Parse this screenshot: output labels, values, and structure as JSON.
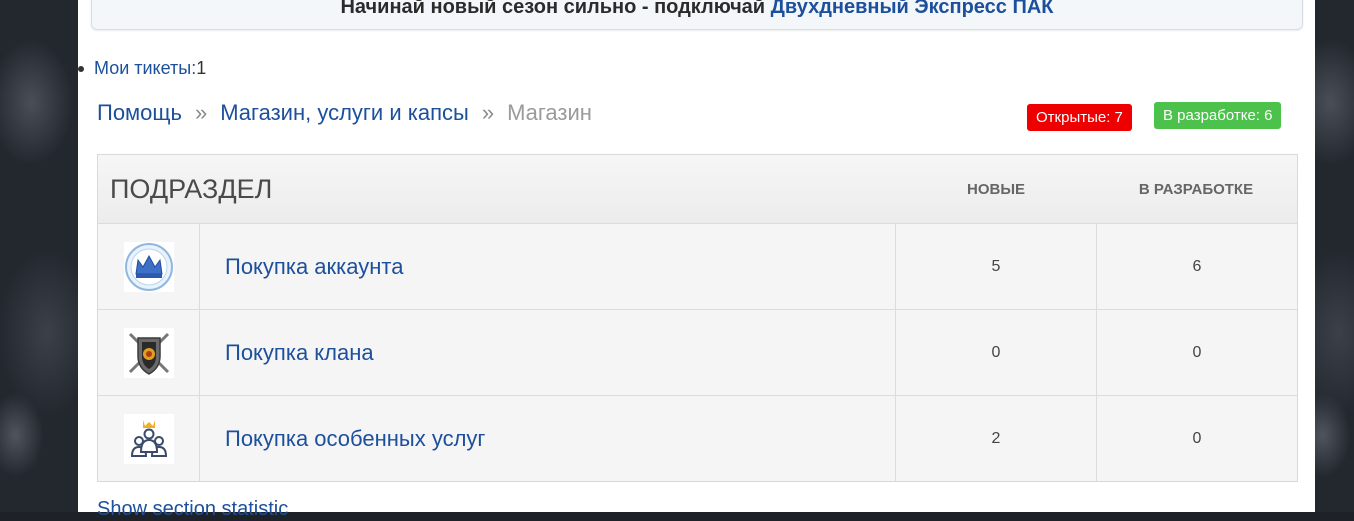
{
  "banner": {
    "text": "Начинай новый сезон сильно - подключай ",
    "highlight": "Двухдневный Экспресс ПАК"
  },
  "tickets": {
    "label": "Мои тикеты:",
    "count": "1"
  },
  "breadcrumb": {
    "items": [
      "Помощь",
      "Магазин, услуги и капсы"
    ],
    "separator": "»",
    "current": "Магазин"
  },
  "badges": {
    "open": "Открытые: 7",
    "in_dev": "В разработке: 6"
  },
  "table": {
    "header": {
      "title": "ПОДРАЗДЕЛ",
      "col_new": "НОВЫЕ",
      "col_dev": "В РАЗРАБОТКЕ"
    },
    "rows": [
      {
        "icon": "crown-icon",
        "name": "Покупка аккаунта",
        "new": "5",
        "dev": "6"
      },
      {
        "icon": "shield-swords-icon",
        "name": "Покупка клана",
        "new": "0",
        "dev": "0"
      },
      {
        "icon": "users-crown-icon",
        "name": "Покупка особенных услуг",
        "new": "2",
        "dev": "0"
      }
    ]
  },
  "footer": {
    "link": "Show section statistic"
  },
  "colors": {
    "link": "#1c4f9c",
    "badge_open": "#ee0000",
    "badge_dev": "#4cc24c"
  }
}
